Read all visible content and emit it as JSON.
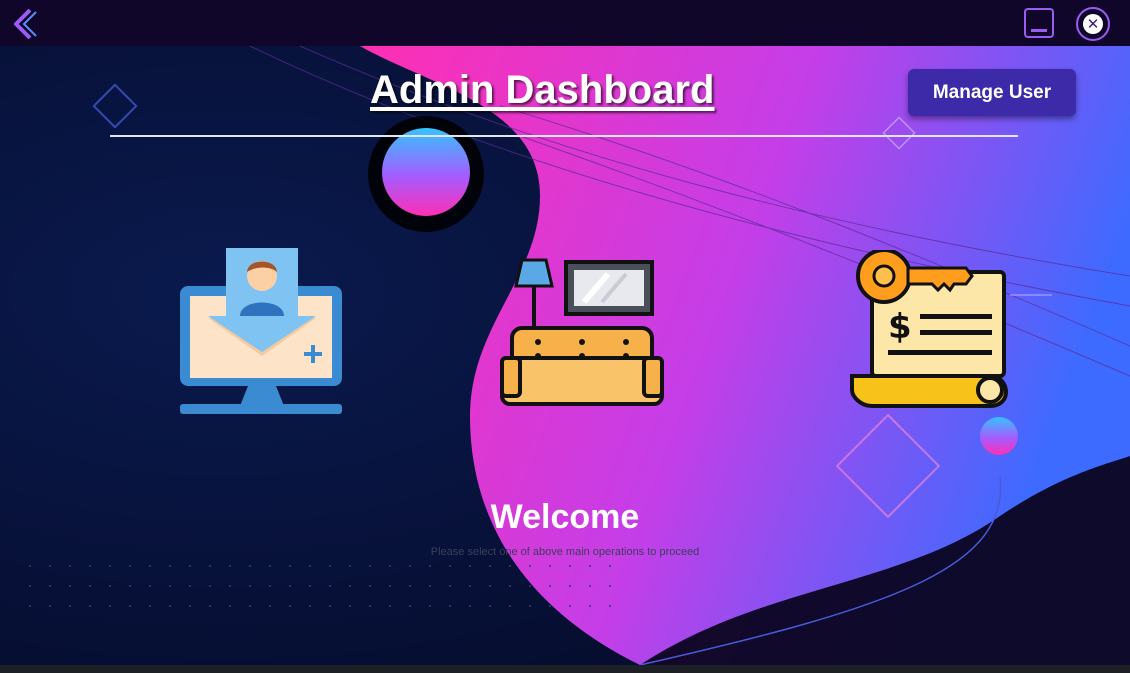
{
  "header": {
    "title": "Admin Dashboard",
    "manage_user_label": "Manage User"
  },
  "tiles": [
    {
      "id": "register",
      "icon": "monitor-user-download-icon"
    },
    {
      "id": "rooms",
      "icon": "sofa-lamp-tv-icon"
    },
    {
      "id": "rent",
      "icon": "key-contract-icon"
    }
  ],
  "welcome": {
    "heading": "Welcome",
    "subtitle": "Please select one of above main operations to proceed"
  },
  "colors": {
    "titlebar": "#10062a",
    "accent": "#9b5cf3",
    "button": "#3c2aa8",
    "magenta": "#ff2fb3",
    "navy": "#06103a"
  }
}
